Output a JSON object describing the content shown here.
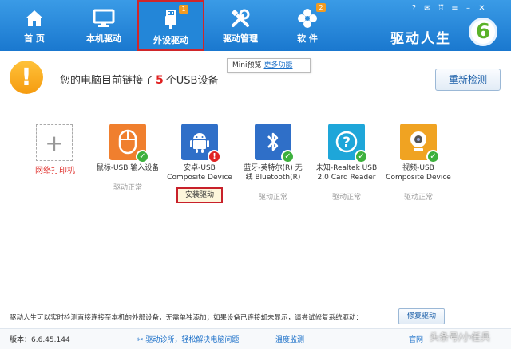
{
  "nav": {
    "home": "首 页",
    "local": "本机驱动",
    "external": "外设驱动",
    "external_badge": "1",
    "manage": "驱动管理",
    "software": "软 件",
    "software_badge": "2"
  },
  "brand": "驱动人生",
  "logo_text": "6",
  "header": {
    "prefix": "您的电脑目前链接了",
    "count": "5",
    "suffix": "个USB设备",
    "tip_label": "Mini预览",
    "tip_link": "更多功能",
    "rescan": "重新检测"
  },
  "add_printer": "网络打印机",
  "devices": [
    {
      "line1": "鼠标-USB 输入设备",
      "line2": "",
      "status": "驱动正常"
    },
    {
      "line1": "安卓-USB",
      "line2": "Composite Device",
      "status": "安装驱动"
    },
    {
      "line1": "蓝牙-英特尔(R) 无",
      "line2": "线 Bluetooth(R)",
      "status": "驱动正常"
    },
    {
      "line1": "未知-Realtek USB",
      "line2": "2.0 Card Reader",
      "status": "驱动正常"
    },
    {
      "line1": "视频-USB",
      "line2": "Composite Device",
      "status": "驱动正常"
    }
  ],
  "footer": {
    "note": "驱动人生可以实时检测直接连接至本机的外部设备，无需单独添加；如果设备已连接却未显示，请尝试修复系统驱动：",
    "repair": "修复驱动",
    "version": "版本：6.6.45.144",
    "diag": "驱动诊所，轻松解决电脑问题",
    "temp": "温度监测",
    "site": "官网",
    "watermark": "头条号/小任兵"
  },
  "colors": {
    "accent": "#1a78cf",
    "alert": "#f59b0f",
    "ok": "#3db03d",
    "error": "#e02424",
    "highlight": "#c8202a"
  }
}
